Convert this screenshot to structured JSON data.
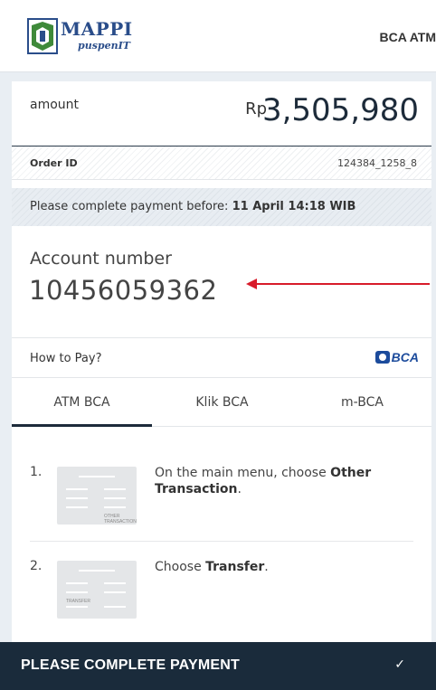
{
  "header": {
    "logo_text": "MAPPI",
    "logo_sub": "puspenIT",
    "title": "BCA ATM"
  },
  "payment": {
    "amount_label": "amount",
    "currency": "Rp",
    "amount": "3,505,980",
    "order_label": "Order ID",
    "order_id": "124384_1258_8",
    "deadline_prefix": "Please complete payment before:",
    "deadline": "11 April 14:18 WIB",
    "account_label": "Account number",
    "account_number": "10456059362"
  },
  "howto": {
    "label": "How to Pay?",
    "bank_logo": "BCA"
  },
  "tabs": [
    {
      "label": "ATM BCA",
      "active": true
    },
    {
      "label": "Klik BCA",
      "active": false
    },
    {
      "label": "m-BCA",
      "active": false
    }
  ],
  "steps": [
    {
      "num": "1.",
      "text_prefix": "On the main menu, choose",
      "text_bold": "Other Transaction",
      "text_suffix": ".",
      "img_caption": "OTHER TRANSACTION"
    },
    {
      "num": "2.",
      "text_prefix": "Choose",
      "text_bold": "Transfer",
      "text_suffix": ".",
      "img_caption": "TRANSFER"
    }
  ],
  "footer": {
    "label": "PLEASE COMPLETE PAYMENT",
    "icon": "checkmark-icon"
  },
  "colors": {
    "dark_navy": "#1a2b3b",
    "bca_blue": "#1c4b9c",
    "arrow_red": "#d81b2a"
  }
}
